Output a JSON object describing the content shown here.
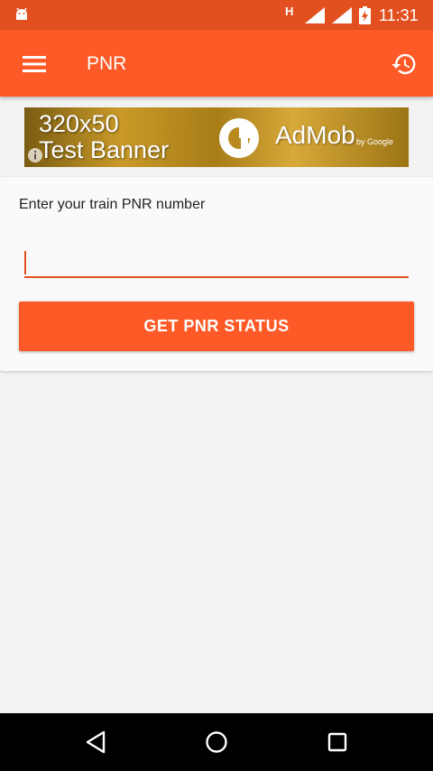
{
  "status_bar": {
    "network_type": "H",
    "time": "11:31"
  },
  "app_bar": {
    "title": "PNR",
    "menu_icon": "hamburger-menu-icon",
    "history_icon": "history-icon"
  },
  "ad_banner": {
    "text": "320x50\nTest Banner",
    "brand": "AdMob",
    "brand_sub": "by Google"
  },
  "form": {
    "prompt": "Enter your train PNR number",
    "input_value": "",
    "input_placeholder": "",
    "button_label": "GET PNR STATUS"
  },
  "colors": {
    "status_bar": "#e2501f",
    "app_bar": "#fe5a27",
    "accent": "#fe5a27"
  }
}
